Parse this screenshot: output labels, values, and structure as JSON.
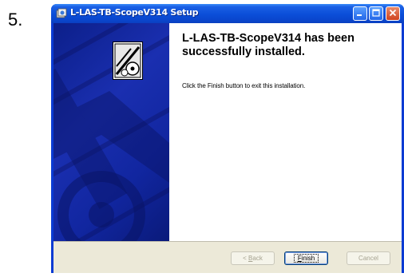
{
  "step": {
    "number": "5."
  },
  "window": {
    "title": "L-LAS-TB-ScopeV314 Setup",
    "icons": {
      "app": "installer-icon",
      "minimize": "minimize-icon",
      "maximize": "maximize-icon",
      "close": "close-icon",
      "banner": "installer-logo-icon"
    }
  },
  "content": {
    "heading": "L-LAS-TB-ScopeV314 has been successfully installed.",
    "body": "Click the Finish button to exit this installation."
  },
  "buttons": {
    "back_prefix": "< ",
    "back_key": "B",
    "back_rest": "ack",
    "finish_key": "F",
    "finish_rest": "inish",
    "cancel": "Cancel"
  },
  "colors": {
    "titlebar": "#0b4ed8",
    "side_panel": "#1126a0",
    "footer": "#ece9d8",
    "close_button": "#d0441f"
  }
}
